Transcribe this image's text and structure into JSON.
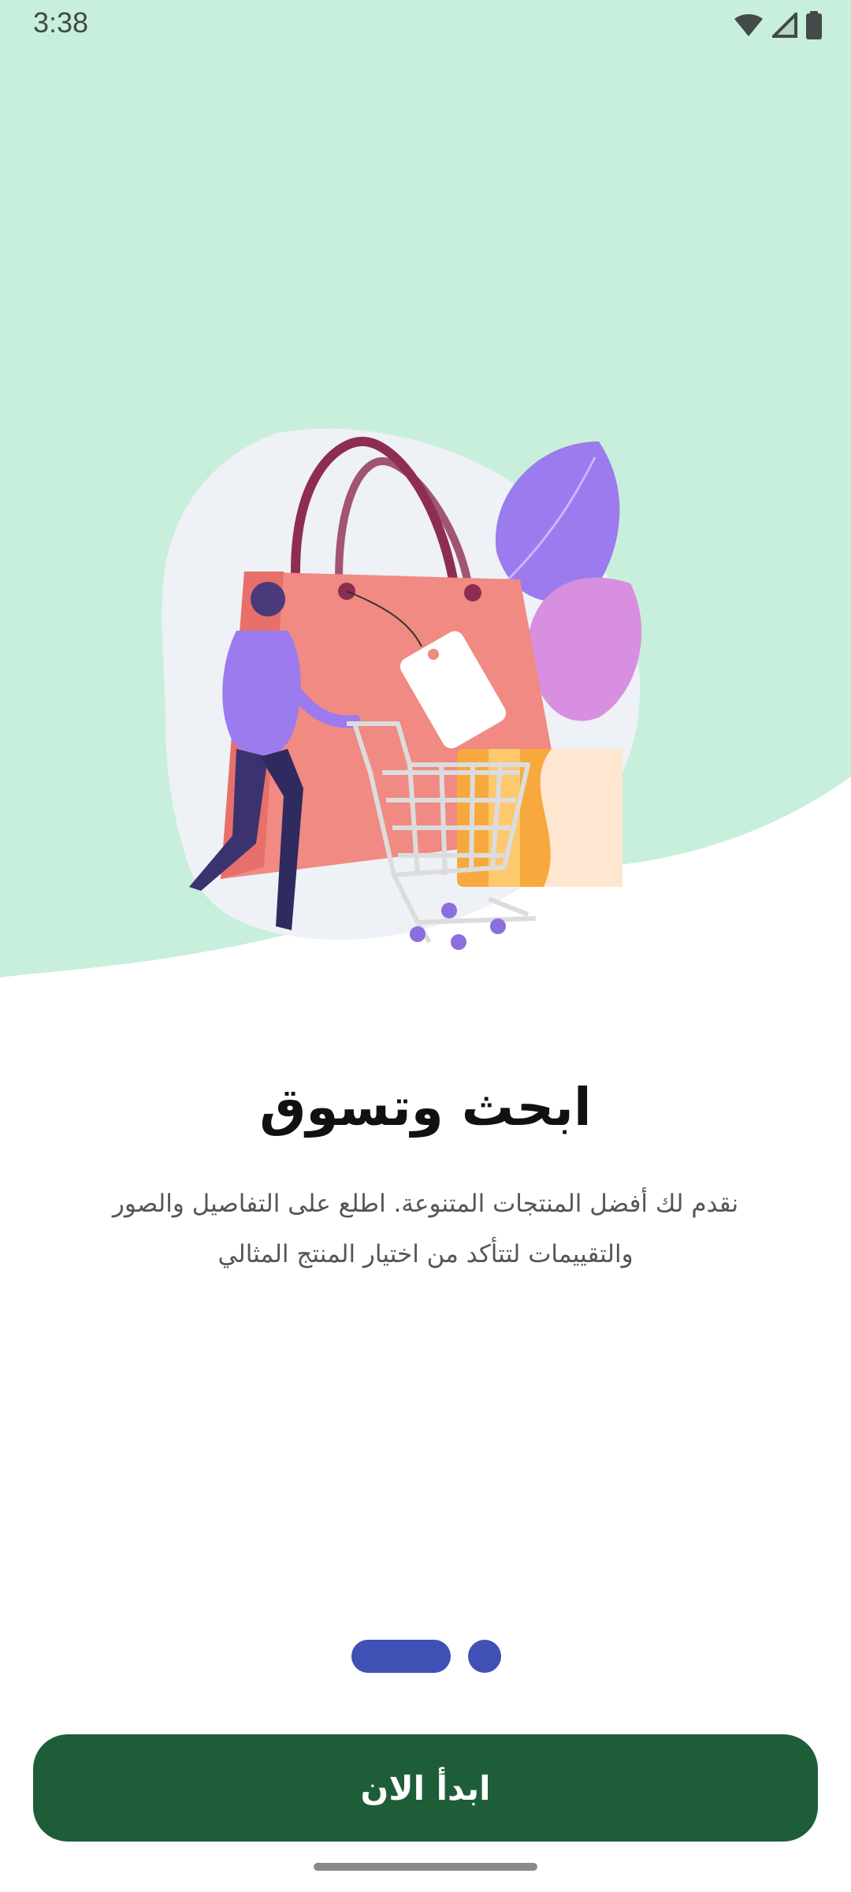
{
  "status_bar": {
    "time": "3:38",
    "icons": [
      "wifi-icon",
      "cell-signal-icon",
      "battery-icon"
    ]
  },
  "onboarding": {
    "title": "ابحث وتسوق",
    "description_line1": "نقدم لك أفضل المنتجات المتنوعة. اطلع على التفاصيل والصور",
    "description_line2": "والتقييمات لتتأكد من اختيار المنتج المثالي",
    "page_indicator": {
      "current": 1,
      "total": 2
    }
  },
  "cta": {
    "label": "ابدأ الان"
  },
  "colors": {
    "background_top": "#c8efdb",
    "accent_indicator": "#3f51b5",
    "button": "#1d5e38",
    "title": "#111111",
    "body_text": "#555555"
  }
}
